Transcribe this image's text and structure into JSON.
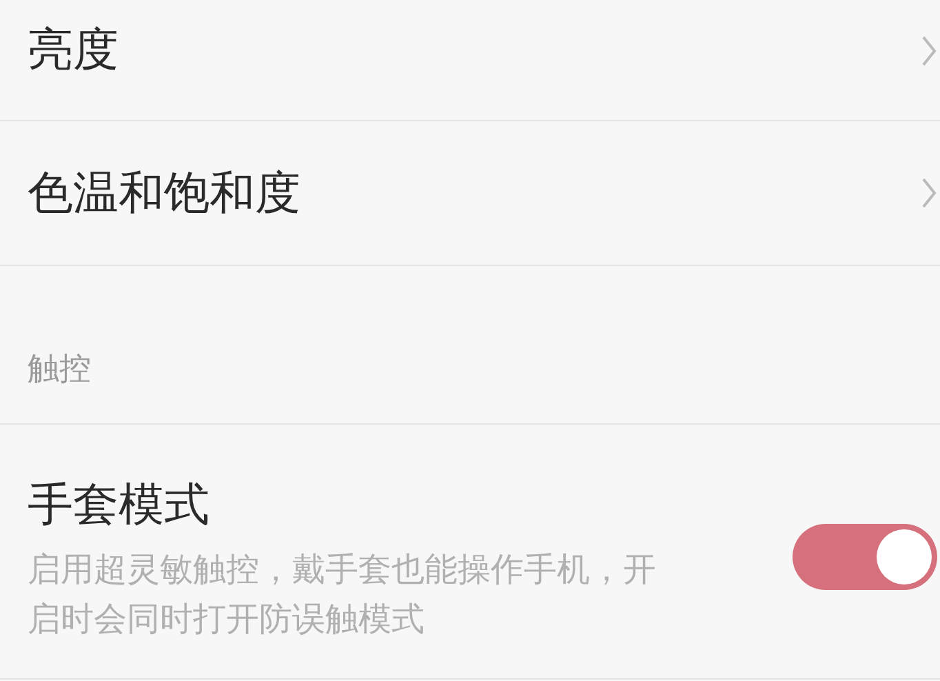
{
  "items": [
    {
      "kind": "link",
      "label": "亮度"
    },
    {
      "kind": "link",
      "label": "色温和饱和度"
    },
    {
      "kind": "header",
      "label": "触控"
    },
    {
      "kind": "toggle",
      "label": "手套模式",
      "description": "启用超灵敏触控，戴手套也能操作手机，开启时会同时打开防误触模式",
      "on": true
    }
  ]
}
